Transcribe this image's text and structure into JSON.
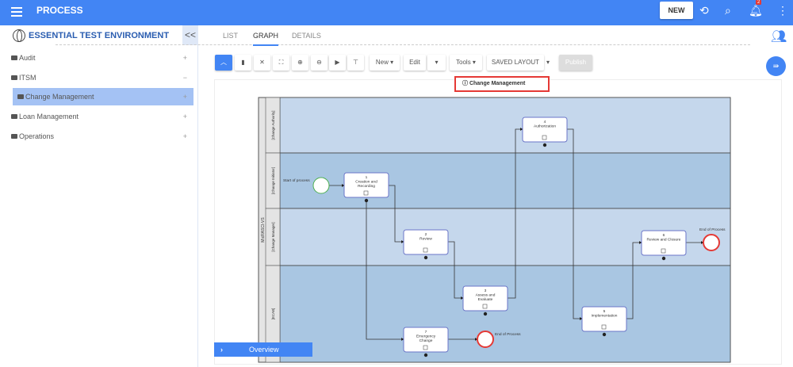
{
  "header": {
    "title": "PROCESS",
    "new_label": "NEW",
    "notification_count": "2"
  },
  "sidebar": {
    "environment": "ESSENTIAL TEST ENVIRONMENT",
    "collapse": "<<",
    "items": [
      {
        "label": "Audit",
        "toggle": "+"
      },
      {
        "label": "ITSM",
        "toggle": "−"
      },
      {
        "label": "Change Management",
        "toggle": "+"
      },
      {
        "label": "Loan Management",
        "toggle": "+"
      },
      {
        "label": "Operations",
        "toggle": "+"
      }
    ]
  },
  "tabs": [
    {
      "label": "LIST"
    },
    {
      "label": "GRAPH"
    },
    {
      "label": "DETAILS"
    }
  ],
  "toolbar": {
    "new": "New ▾",
    "edit": "Edit",
    "edit_caret": "▾",
    "tools": "Tools ▾",
    "saved_layout": "SAVED LAYOUT",
    "saved_caret": "▾",
    "publish": "Publish"
  },
  "diagram": {
    "title": "Change Management",
    "pool": "MicRASCI-VS",
    "lanes": [
      "[Change Authority]",
      "[Change Initiator]",
      "[Change Manager]",
      "[ECAB]"
    ],
    "nodes": [
      {
        "num": "1",
        "lines": [
          "Creation and",
          "Recording"
        ]
      },
      {
        "num": "2",
        "lines": [
          "Review"
        ]
      },
      {
        "num": "3",
        "lines": [
          "Assess and",
          "Evaluate"
        ]
      },
      {
        "num": "4",
        "lines": [
          "Authorization"
        ]
      },
      {
        "num": "5",
        "lines": [
          "Implementation"
        ]
      },
      {
        "num": "6",
        "lines": [
          "Review and Closure"
        ]
      },
      {
        "num": "7",
        "lines": [
          "Emergency",
          "Change"
        ]
      }
    ],
    "start_label": "Start of process",
    "end_labels": [
      "End of Process",
      "End of Process"
    ]
  },
  "overview": {
    "label": "Overview"
  }
}
